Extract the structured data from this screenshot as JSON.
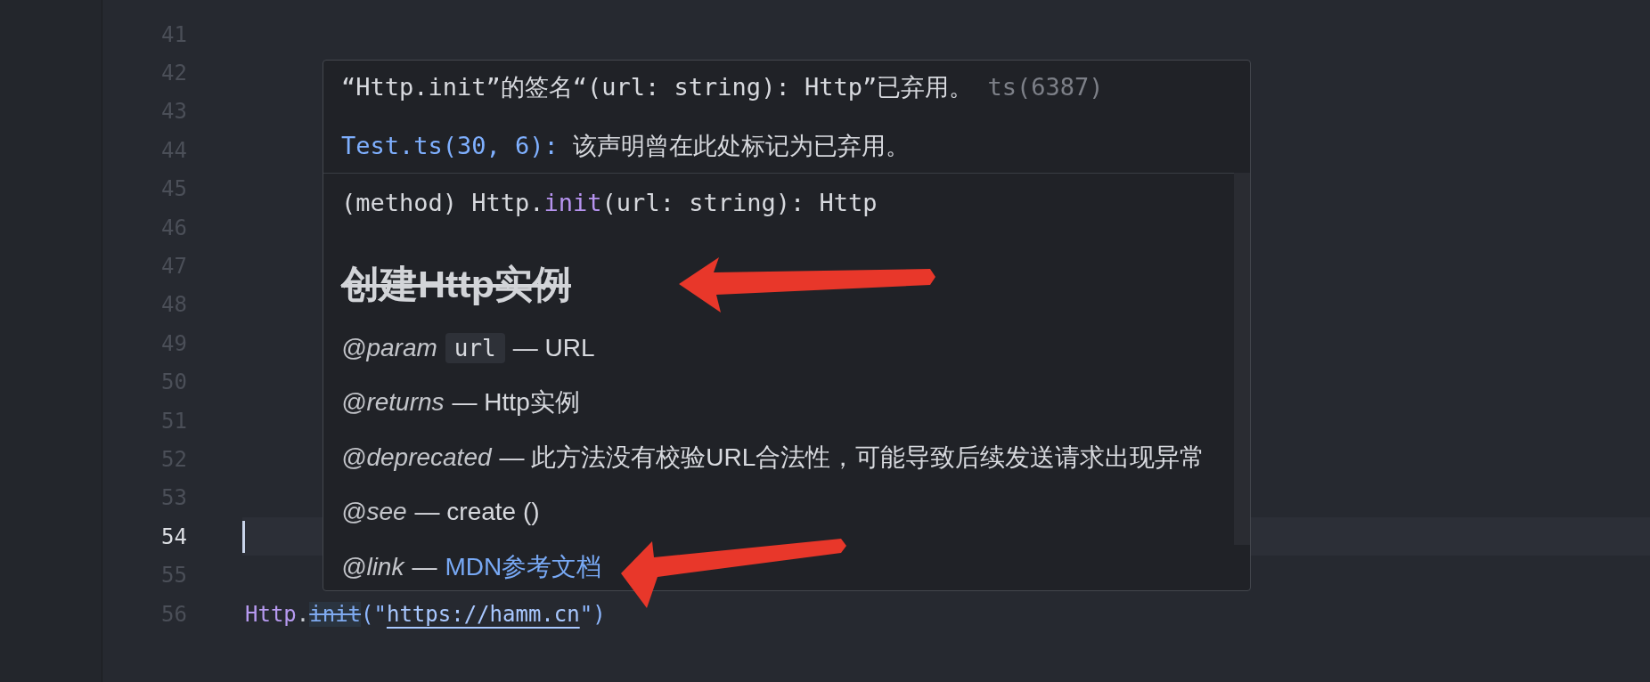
{
  "editor": {
    "lines": [
      {
        "number": "41",
        "current": false
      },
      {
        "number": "42",
        "current": false
      },
      {
        "number": "43",
        "current": false
      },
      {
        "number": "44",
        "current": false
      },
      {
        "number": "45",
        "current": false
      },
      {
        "number": "46",
        "current": false
      },
      {
        "number": "47",
        "current": false
      },
      {
        "number": "48",
        "current": false
      },
      {
        "number": "49",
        "current": false
      },
      {
        "number": "50",
        "current": false
      },
      {
        "number": "51",
        "current": false
      },
      {
        "number": "52",
        "current": false
      },
      {
        "number": "53",
        "current": false
      },
      {
        "number": "54",
        "current": true
      },
      {
        "number": "55",
        "current": false
      },
      {
        "number": "56",
        "current": false,
        "code": [
          {
            "text": "Http",
            "kind": "class"
          },
          {
            "text": ".",
            "kind": "punct"
          },
          {
            "text": "init",
            "kind": "deprecated"
          },
          {
            "text": "(\"",
            "kind": "string"
          },
          {
            "text": "https://hamm.cn",
            "kind": "link"
          },
          {
            "text": "\")",
            "kind": "string"
          }
        ]
      }
    ]
  },
  "hover": {
    "message": {
      "text": "“Http.init”的签名“(url: string): Http”已弃用。",
      "code": "ts(6387)"
    },
    "related": {
      "location": "Test.ts(30, 6):",
      "message": "该声明曾在此处标记为已弃用。"
    },
    "signature": [
      {
        "text": "(method) Http.",
        "kind": "plain"
      },
      {
        "text": "init",
        "kind": "method"
      },
      {
        "text": "(url: string): Http",
        "kind": "plain"
      }
    ],
    "heading": {
      "text": "创建Http实例",
      "deprecated": true
    },
    "tags": [
      {
        "tag": "@param",
        "param": "url",
        "text": "— URL"
      },
      {
        "tag": "@returns",
        "text": "— Http实例"
      },
      {
        "tag": "@deprecated",
        "text": "— 此方法没有校验URL合法性，可能导致后续发送请求出现异常"
      },
      {
        "tag": "@see",
        "text": "— create ()"
      },
      {
        "tag": "@link",
        "text": "—",
        "link": "MDN参考文档"
      }
    ]
  }
}
